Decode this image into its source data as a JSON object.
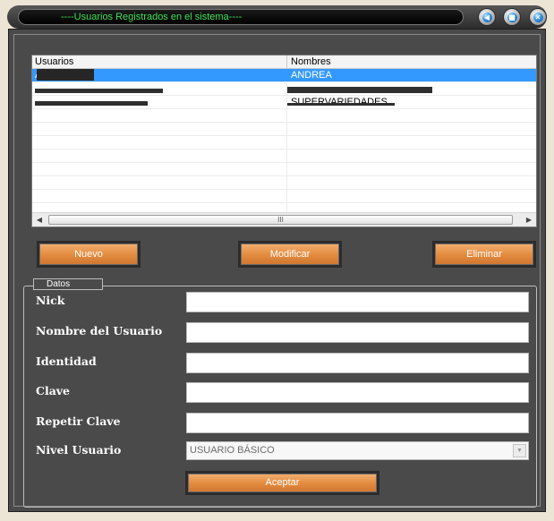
{
  "window": {
    "title": "----Usuarios Registrados en el sistema----",
    "controls": [
      "minimize-icon",
      "maximize-icon",
      "close-icon"
    ]
  },
  "users_table": {
    "headers": [
      "Usuarios",
      "Nombres"
    ],
    "rows": [
      {
        "usuario": "ANDREA",
        "nombre": "ANDREA",
        "selected": true
      },
      {
        "usuario": "",
        "nombre": ""
      },
      {
        "usuario": "",
        "nombre": "SUPERVARIEDADES"
      },
      {
        "usuario": "",
        "nombre": ""
      },
      {
        "usuario": "",
        "nombre": ""
      },
      {
        "usuario": "",
        "nombre": ""
      },
      {
        "usuario": "",
        "nombre": ""
      },
      {
        "usuario": "",
        "nombre": ""
      },
      {
        "usuario": "",
        "nombre": ""
      },
      {
        "usuario": "",
        "nombre": ""
      },
      {
        "usuario": "",
        "nombre": ""
      }
    ],
    "scrollbar_grip": "III"
  },
  "actions": {
    "nuevo": "Nuevo",
    "modificar": "Modificar",
    "eliminar": "Eliminar"
  },
  "datos": {
    "group_label": "Datos",
    "nick_label": "Nick",
    "nombre_label": "Nombre del Usuario",
    "identidad_label": "Identidad",
    "clave_label": "Clave",
    "repetir_label": "Repetir Clave",
    "nivel_label": "Nivel Usuario",
    "nick_value": "",
    "nombre_value": "",
    "identidad_value": "",
    "clave_value": "",
    "repetir_value": "",
    "nivel_value": "USUARIO BÁSICO",
    "aceptar": "Aceptar"
  },
  "colors": {
    "title_text": "#3fe05a",
    "panel": "#4a4a4a",
    "button_orange": "#e28a3e",
    "selection": "#3399ff"
  }
}
